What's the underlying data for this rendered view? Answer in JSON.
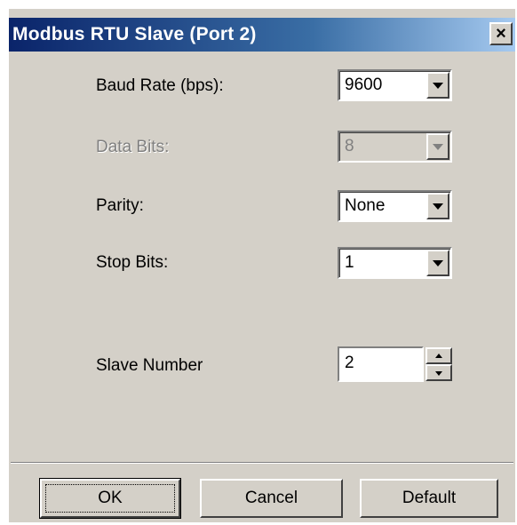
{
  "window": {
    "title": "Modbus RTU Slave (Port 2)",
    "close_label": "×"
  },
  "fields": [
    {
      "label": "Baud Rate (bps):",
      "value": "9600",
      "enabled": true
    },
    {
      "label": "Data Bits:",
      "value": "8",
      "enabled": false
    },
    {
      "label": "Parity:",
      "value": "None",
      "enabled": true
    },
    {
      "label": "Stop Bits:",
      "value": "1",
      "enabled": true
    }
  ],
  "slave": {
    "label": "Slave Number",
    "value": "2"
  },
  "buttons": {
    "ok": "OK",
    "cancel": "Cancel",
    "default": "Default"
  },
  "colors": {
    "face": "#d4d0c8",
    "titlebar_start": "#0a246a",
    "titlebar_end": "#a6caf0"
  }
}
